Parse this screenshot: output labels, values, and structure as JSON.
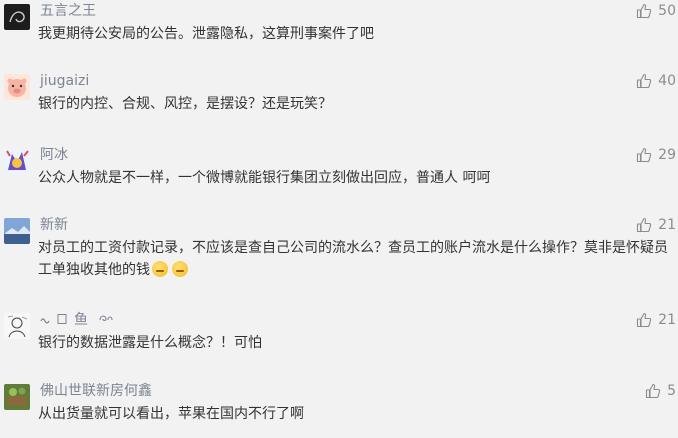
{
  "colors": {
    "name": "#7b8592",
    "text": "#333333",
    "like": "#8c8c8c",
    "background": "#f2f2f2"
  },
  "comments": [
    {
      "name": "五言之王",
      "text": "我更期待公安局的公告。泄露隐私，这算刑事案件了吧",
      "likes": "50",
      "avatar_icon": "dark-swirl-avatar"
    },
    {
      "name": "jiugaizi",
      "text": "银行的内控、合规、风控，是摆设？还是玩笑？",
      "likes": "40",
      "avatar_icon": "cartoon-pig-avatar"
    },
    {
      "name": "阿冰",
      "text": "公众人物就是不一样，一个微博就能银行集团立刻做出回应，普通人 呵呵",
      "likes": "29",
      "avatar_icon": "colorful-character-avatar"
    },
    {
      "name": "新新",
      "text": "对员工的工资付款记录，不应该是查自己公司的流水么？查员工的账户流水是什么操作？莫非是怀疑员工单独收其他的钱",
      "likes": "21",
      "avatar_icon": "landscape-avatar",
      "emojis": [
        "thinking-emoji",
        "thinking-emoji"
      ]
    },
    {
      "name": "鱼",
      "text": "银行的数据泄露是什么概念？！可怕",
      "likes": "21",
      "avatar_icon": "sketch-avatar",
      "name_icons": [
        "wave-symbol",
        "box-symbol"
      ],
      "name_suffix_icon": "swirl-symbol"
    },
    {
      "name": "佛山世联新房何鑫",
      "text": "从出货量就可以看出，苹果在国内不行了啊",
      "likes": "5",
      "avatar_icon": "green-photo-avatar"
    }
  ]
}
